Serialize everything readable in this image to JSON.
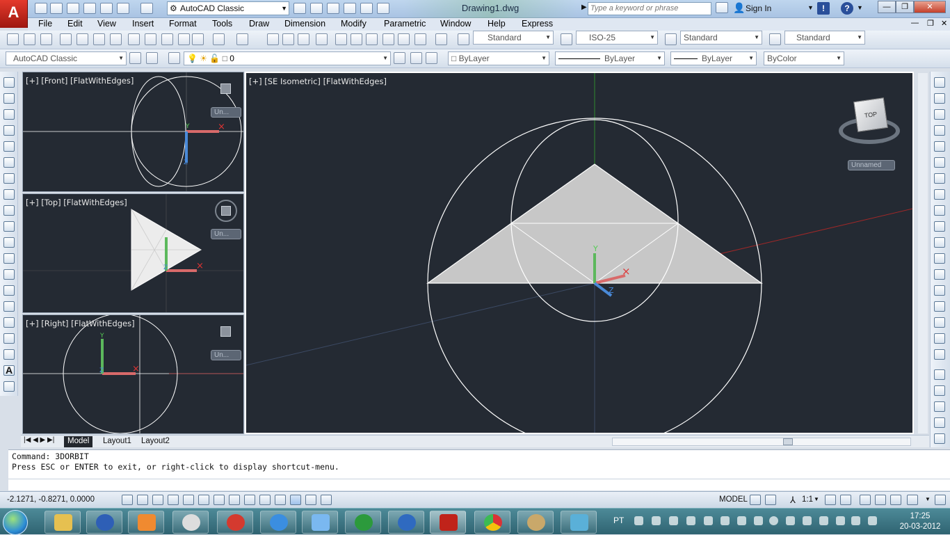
{
  "titlebar": {
    "workspace": "AutoCAD Classic",
    "document_title": "Drawing1.dwg",
    "search_placeholder": "Type a keyword or phrase",
    "sign_in": "Sign In"
  },
  "menu": [
    "File",
    "Edit",
    "View",
    "Insert",
    "Format",
    "Tools",
    "Draw",
    "Dimension",
    "Modify",
    "Parametric",
    "Window",
    "Help",
    "Express"
  ],
  "styles_toolbar": {
    "text_style": "Standard",
    "dim_style": "ISO-25",
    "table_style": "Standard",
    "multileader_style": "Standard"
  },
  "layers_toolbar": {
    "workspace": "AutoCAD Classic",
    "layer": "0",
    "color": "ByLayer",
    "linetype": "ByLayer",
    "lineweight": "ByLayer",
    "plotstyle": "ByColor"
  },
  "viewports": {
    "front": {
      "label": "[+] [Front] [FlatWithEdges]",
      "ucs": "Un..."
    },
    "top": {
      "label": "[+] [Top] [FlatWithEdges]",
      "ucs": "Un..."
    },
    "right": {
      "label": "[+] [Right] [FlatWithEdges]",
      "ucs": "Un..."
    },
    "iso": {
      "label": "[+] [SE Isometric] [FlatWithEdges]",
      "ucs": "Unnamed",
      "viewcube_face": "TOP"
    }
  },
  "layout_tabs": [
    "Model",
    "Layout1",
    "Layout2"
  ],
  "command": {
    "line1": "Command: 3DORBIT",
    "line2": "Press ESC or ENTER to exit, or right-click to display shortcut-menu."
  },
  "status": {
    "coords": "-2.1271, -0.8271, 0.0000",
    "space": "MODEL",
    "annotation_scale": "1:1"
  },
  "taskbar": {
    "language": "PT",
    "time": "17:25",
    "date": "20-03-2012"
  }
}
